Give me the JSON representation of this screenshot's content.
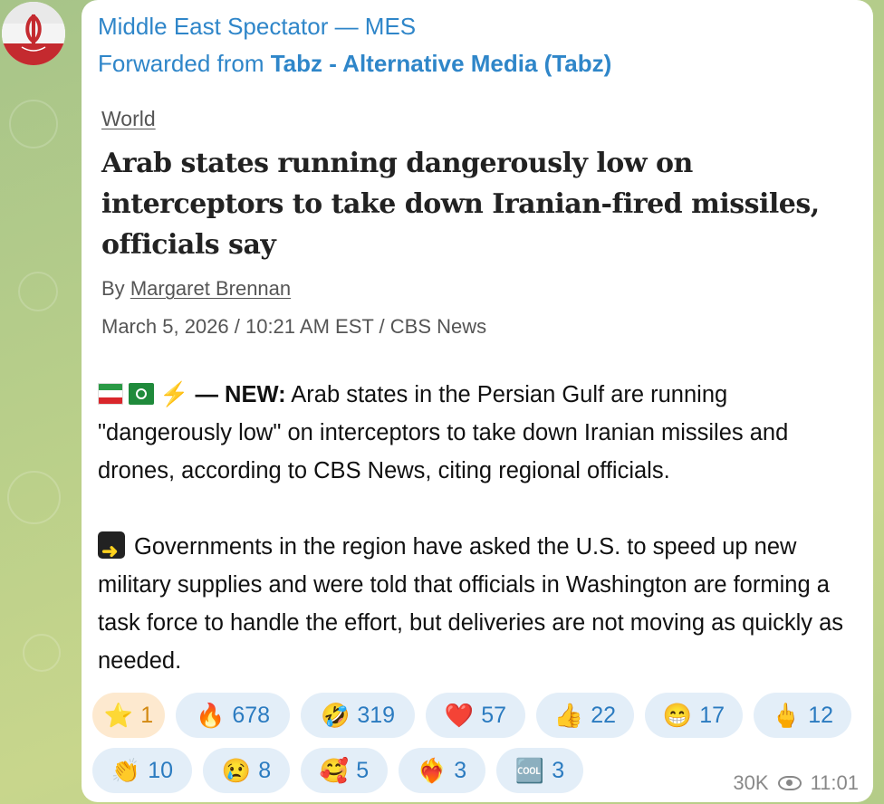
{
  "channel": {
    "name": "Middle East Spectator — MES",
    "forwarded_prefix": "Forwarded from",
    "forwarded_source": "Tabz - Alternative Media (Tabz)"
  },
  "article": {
    "section": "World",
    "headline": "Arab states running dangerously low on interceptors to take down Iranian-fired missiles, officials say",
    "byline_prefix": "By",
    "author": "Margaret Brennan",
    "dateline": "March 5, 2026 / 10:21 AM EST / CBS News"
  },
  "message": {
    "para1_lead": "— NEW:",
    "para1_text": "Arab states in the Persian Gulf are running \"dangerously low\" on interceptors to take down Iranian missiles and drones, according to CBS News, citing regional officials.",
    "para2_text": "Governments in the region have asked the U.S. to speed up new military supplies and were told that officials in Washington are forming a task force to handle the effort, but deliveries are not moving as quickly as needed.",
    "emoji_bolt": "⚡"
  },
  "reactions": [
    {
      "emoji": "⭐",
      "count": "1",
      "active": true
    },
    {
      "emoji": "🔥",
      "count": "678"
    },
    {
      "emoji": "🤣",
      "count": "319"
    },
    {
      "emoji": "❤️",
      "count": "57"
    },
    {
      "emoji": "👍",
      "count": "22"
    },
    {
      "emoji": "😁",
      "count": "17"
    },
    {
      "emoji": "🖕",
      "count": "12"
    },
    {
      "emoji": "👏",
      "count": "10"
    },
    {
      "emoji": "😢",
      "count": "8"
    },
    {
      "emoji": "🥰",
      "count": "5"
    },
    {
      "emoji": "❤️‍🔥",
      "count": "3"
    },
    {
      "emoji": "🆒",
      "count": "3"
    }
  ],
  "meta": {
    "views": "30K",
    "time": "11:01"
  },
  "colors": {
    "link": "#2f86c9",
    "chip_bg": "#e3eef8",
    "chip_active_bg": "#fde9cf"
  }
}
